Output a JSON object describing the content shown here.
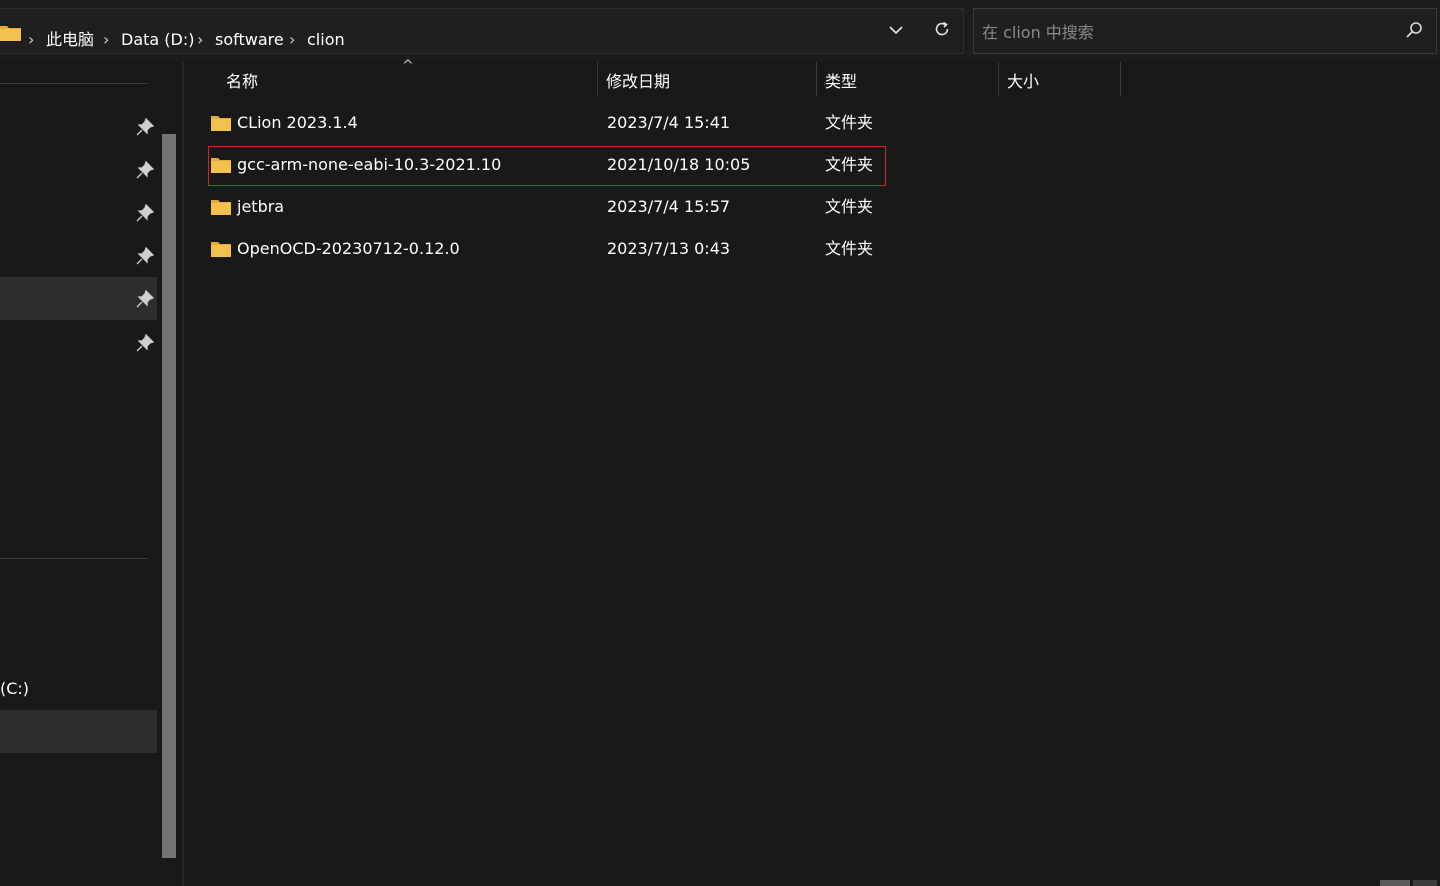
{
  "breadcrumb": {
    "items": [
      "此电脑",
      "Data (D:)",
      "software",
      "clion"
    ],
    "separator": "›"
  },
  "toolbar": {
    "dropdown_icon": "chevron-down-icon",
    "refresh_icon": "refresh-icon"
  },
  "search": {
    "placeholder": "在 clion 中搜索",
    "icon": "search-icon"
  },
  "nav": {
    "drive_label": "(C:)",
    "pin_icon": "pin-icon"
  },
  "columns": {
    "name": "名称",
    "date": "修改日期",
    "type": "类型",
    "size": "大小",
    "sort_indicator": "^"
  },
  "files": [
    {
      "name": "CLion 2023.1.4",
      "date": "2023/7/4 15:41",
      "type": "文件夹",
      "size": ""
    },
    {
      "name": "gcc-arm-none-eabi-10.3-2021.10",
      "date": "2021/10/18 10:05",
      "type": "文件夹",
      "size": ""
    },
    {
      "name": "jetbra",
      "date": "2023/7/4 15:57",
      "type": "文件夹",
      "size": ""
    },
    {
      "name": "OpenOCD-20230712-0.12.0",
      "date": "2023/7/13 0:43",
      "type": "文件夹",
      "size": ""
    }
  ],
  "colors": {
    "background": "#191919",
    "selection_border": "#c42b2b",
    "folder": "#f2c14e"
  }
}
